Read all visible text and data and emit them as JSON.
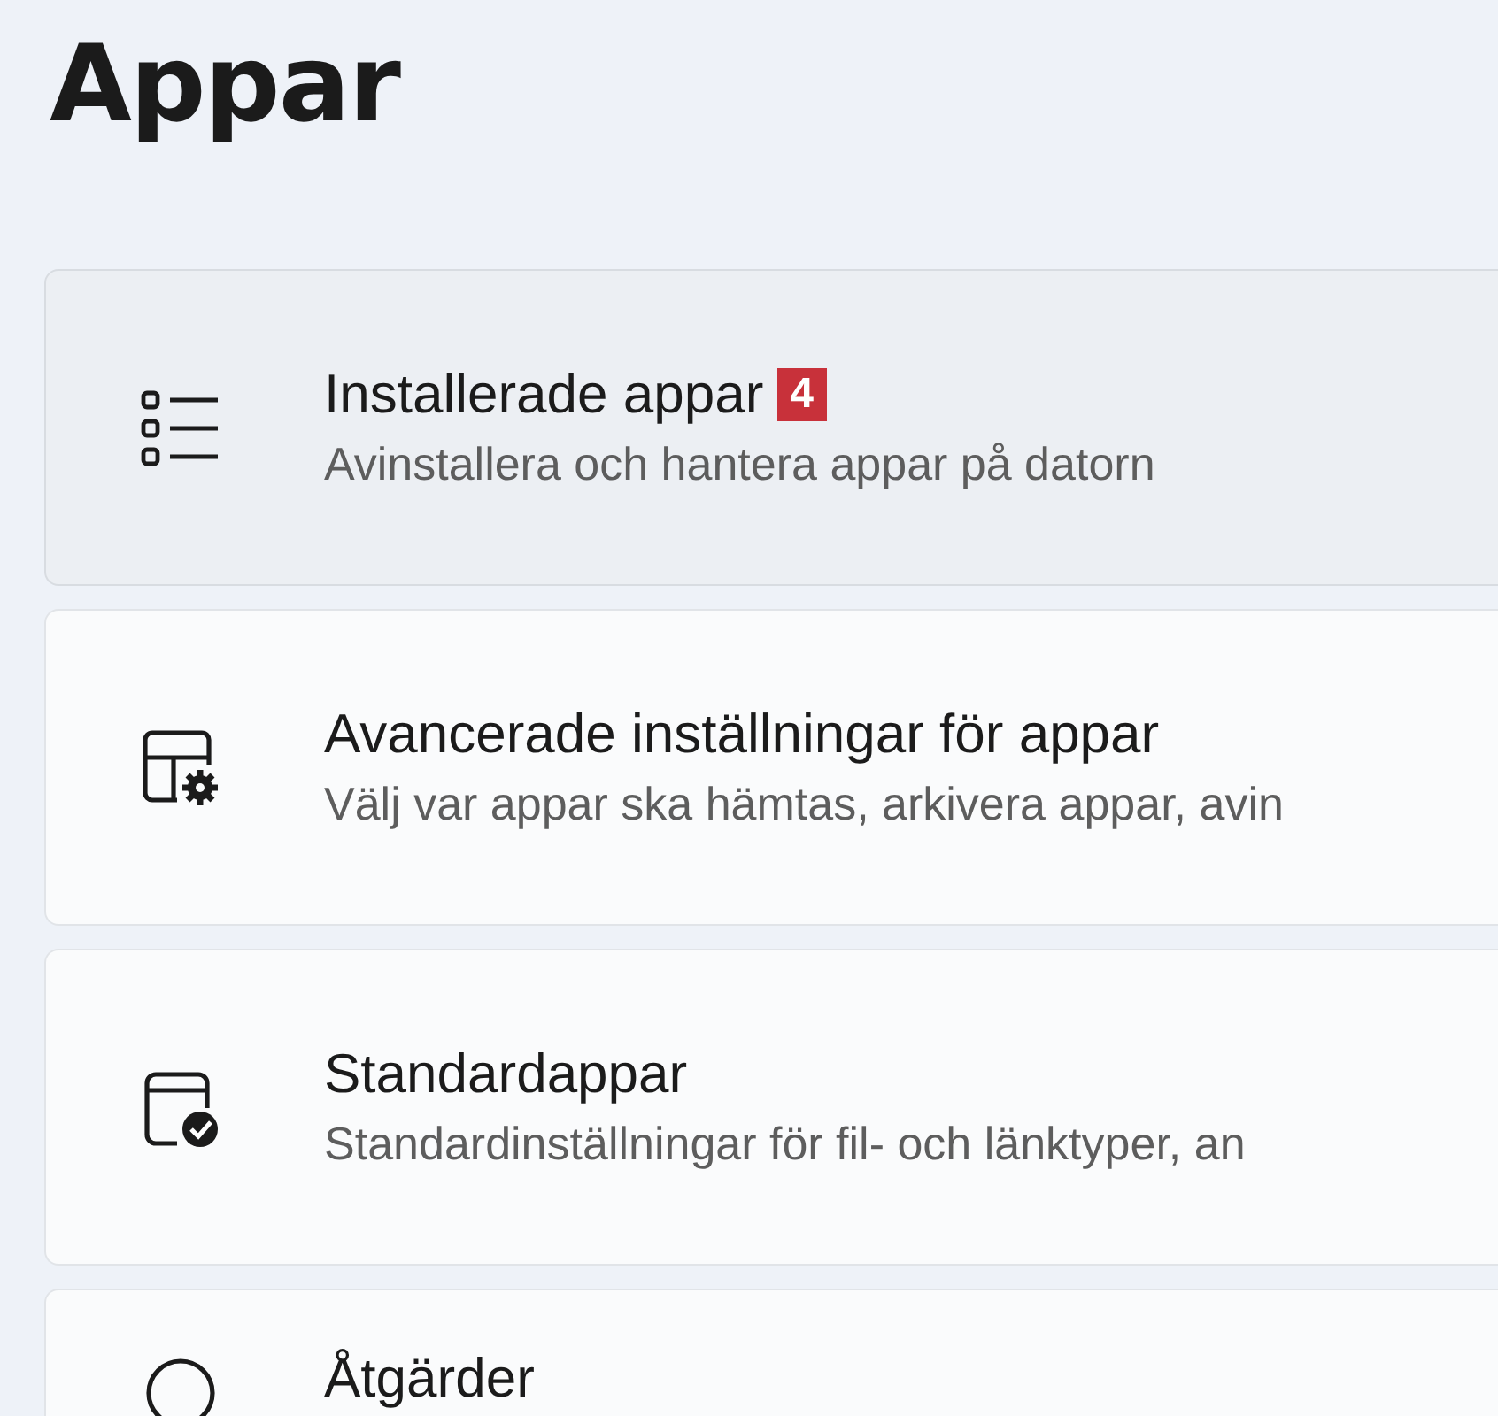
{
  "page_title": "Appar",
  "items": [
    {
      "kind": "list",
      "title": "Installerade appar",
      "badge": "4",
      "subtitle": "Avinstallera och hantera appar på datorn",
      "hovered": true
    },
    {
      "kind": "gear",
      "title": "Avancerade inställningar för appar",
      "subtitle": "Välj var appar ska hämtas, arkivera appar, avin",
      "hovered": false
    },
    {
      "kind": "check",
      "title": "Standardappar",
      "subtitle": "Standardinställningar för fil- och länktyper, an",
      "hovered": false
    },
    {
      "kind": "actions",
      "title": "Åtgärder",
      "hovered": false
    }
  ]
}
